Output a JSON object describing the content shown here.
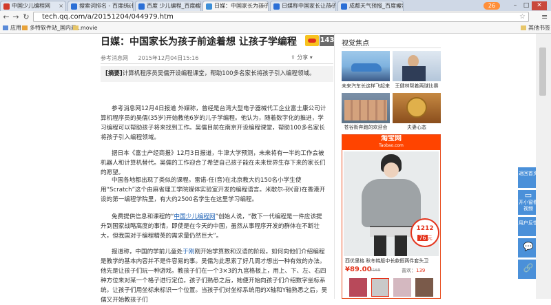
{
  "tabs": [
    {
      "label": "中国少儿编程网",
      "color": "#d23a2a",
      "active": false
    },
    {
      "label": "搜索词排名 - 百度统计",
      "color": "#2b6fd6",
      "active": false
    },
    {
      "label": "百度 少儿编程_百度搜索",
      "color": "#2b6fd6",
      "active": false
    },
    {
      "label": "日媒：中国家长为孩子前途着",
      "color": "#3d8fd8",
      "active": true
    },
    {
      "label": "日媒称中国家长让孩子学编",
      "color": "#2b6fd6",
      "active": false
    },
    {
      "label": "成都天气预报_百度搜索",
      "color": "#2b6fd6",
      "active": false
    }
  ],
  "new_tab_label": "26",
  "address": {
    "url": "tech.qq.com/a/20151204/044979.htm"
  },
  "bookmarks": [
    {
      "label": "应用"
    },
    {
      "label": "多特软件站_国内最..."
    },
    {
      "label": "movie"
    },
    {
      "label": "其他书签"
    }
  ],
  "article": {
    "title": "日媒：中国家长为孩子前途着想 让孩子学编程",
    "comment_count": "143",
    "source": "参考消息网",
    "date": "2015年12月04日15:16",
    "share_label": "分享",
    "abstract_tag": "[摘要]",
    "abstract_text": "计算机程序员吴儒开设编程课堂，帮助100多名家长将孩子引入编程领域。",
    "paragraphs": [
      "参考消息网12月4日报道 外媒称，曾经是台湾大型电子器械代工企业富士康公司计算机程序员的吴儒(35岁)开始教他6岁的儿子学编程。他认为，随着数字化的推进，学习编程可以帮助孩子将来找到工作。吴儒目前在南京开设编程课堂，帮助100多名家长将孩子引入编程领域。",
      "据日本《富士产经商报》12月3日报道，牛津大学预测，未来将有一半的工作会被机器人和计算机替代。吴儒的工作迎合了希望自己孩子能在未来世界生存下来的家长们的愿望。",
      "中国各地都出现了类似的课程。雷诺-任(音)在北京教大约150名小学生使用“Scratch”这个由麻省理工学院媒体实验室开发的编程语言。米歇尔-孙(音)在香港开设的第一编程学院里，有大约2500名学生在这里学习编程。",
      "免费提供信息和课程的",
      "中国少儿编程网",
      "创始人说，“教下一代编程是一件应该提升到国家战略高度的事情，即使是在今天的中国，虽然从事程序开发的群体在不断壮大，但我国对于编程精英的需求量仍然巨大”。",
      "报道称，中国的学前儿童处",
      "于刚",
      "刚开始学算数和汉语的阶段。如何向他们介绍编程是教学的基本内容并不是件容易的事。吴儒为此思索了好几周才想出一种有效的办法。他先是让孩子们玩一种游戏。教孩子们在一个3×3的九宫格板上，用上、下、左、右四种方位来对某一个格子进行定位。孩子们熟悉之后，她便开始向孩子们介绍数字坐标系统，让孩子们用坐标来标识一个位置。当孩子们对坐标系统用的X轴和Y轴熟悉之后，吴儒又开始教孩子们"
    ]
  },
  "sidebar": {
    "heading": "视觉焦点",
    "items": [
      {
        "caption": "未来汽车长这样飞起来"
      },
      {
        "caption": "王健林帮着两球比赛"
      },
      {
        "caption": "苍谷街奔跑的欢迎会"
      },
      {
        "caption": "夫妻心态"
      }
    ]
  },
  "ad": {
    "brand": "淘宝网",
    "domain": "Taobao.com",
    "badge_top": "1212",
    "badge_price": "76",
    "badge_unit": "元",
    "description": "西优里格 秋冬韩版中长款假两件套头卫",
    "price": "¥89.00",
    "old_price": "¥168",
    "likes_label": "喜欢：",
    "likes": "139"
  },
  "float_buttons": [
    {
      "label": "返回首页"
    },
    {
      "label": "开小窗看视频"
    },
    {
      "label": "用户反馈"
    },
    {
      "label": "评论"
    },
    {
      "label": "分享"
    }
  ],
  "colors": {
    "accent": "#4a90d9",
    "taobao": "#ff4400",
    "price": "#e4331b"
  }
}
